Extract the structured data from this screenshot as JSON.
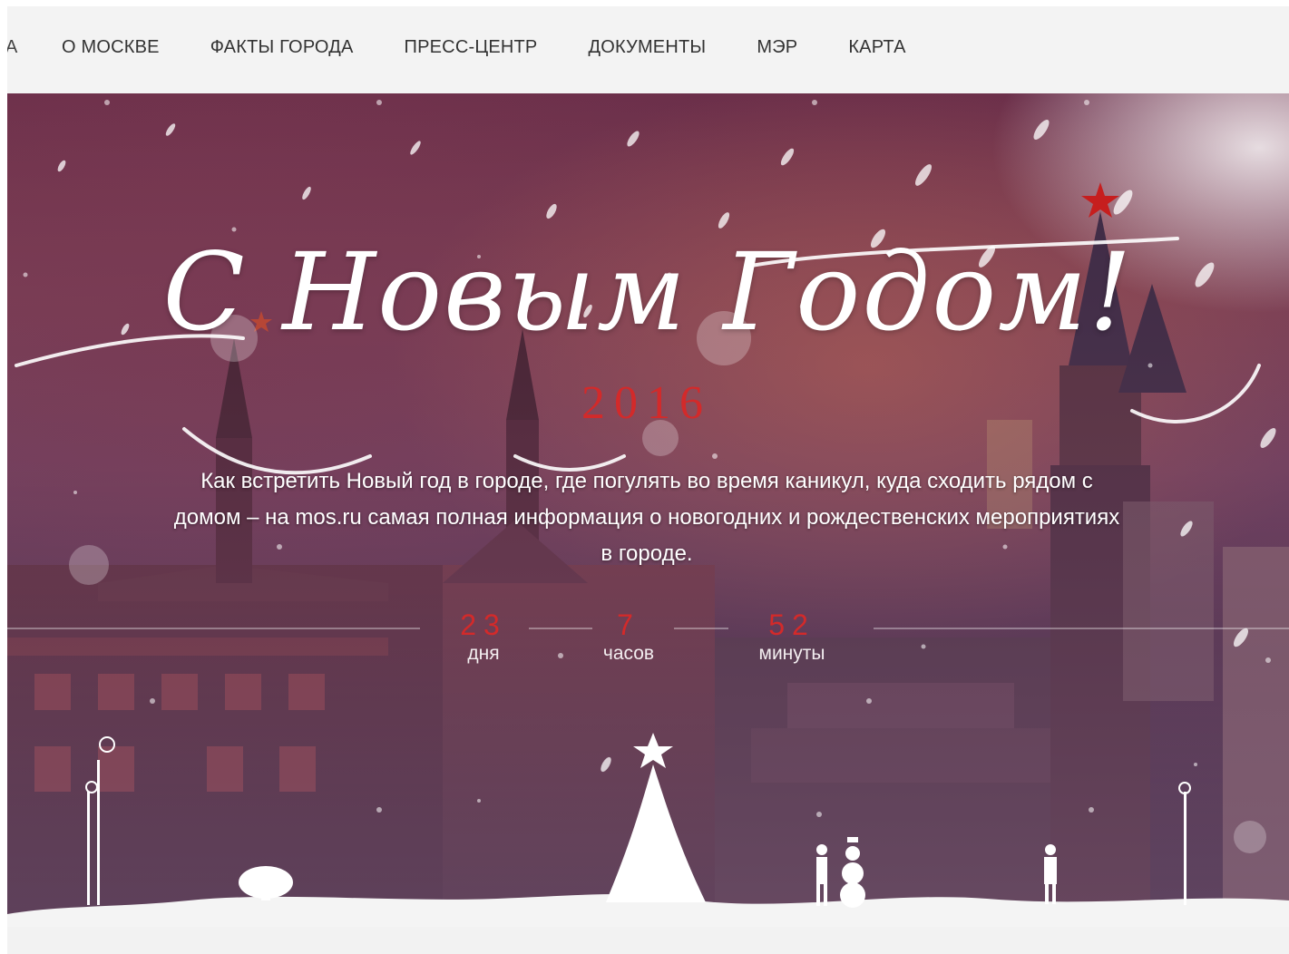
{
  "nav": {
    "cut_item": "А",
    "items": [
      "О МОСКВЕ",
      "ФАКТЫ ГОРОДА",
      "ПРЕСС-ЦЕНТР",
      "ДОКУМЕНТЫ",
      "МЭР",
      "КАРТА"
    ]
  },
  "hero": {
    "greeting": "С Новым Годом!",
    "year": "2016",
    "description": "Как встретить Новый год в городе, где погулять во время каникул, куда сходить рядом с домом – на mos.ru самая полная информация о новогодних и рождественских мероприятиях в городе.",
    "countdown": [
      {
        "value": "23",
        "unit": "дня"
      },
      {
        "value": "7",
        "unit": "часов"
      },
      {
        "value": "52",
        "unit": "минуты"
      }
    ]
  },
  "colors": {
    "accent_red": "#d32a2a",
    "nav_bg": "#f3f3f3",
    "nav_text": "#333333"
  }
}
